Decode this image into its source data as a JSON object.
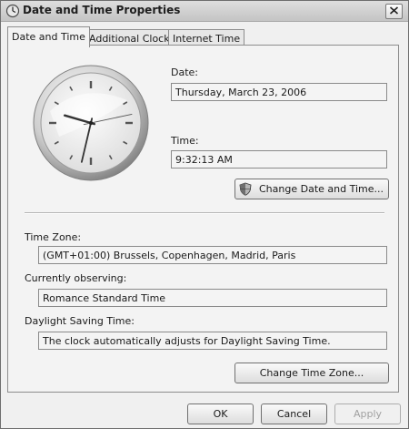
{
  "window": {
    "title": "Date and Time Properties",
    "app_icon": "date-time-icon",
    "close_icon": "close-icon"
  },
  "tabs": [
    {
      "label": "Date and Time",
      "active": true
    },
    {
      "label": "Additional Clocks",
      "active": false
    },
    {
      "label": "Internet Time",
      "active": false
    }
  ],
  "date": {
    "label": "Date:",
    "value": "Thursday, March 23, 2006"
  },
  "time": {
    "label": "Time:",
    "value": "9:32:13 AM"
  },
  "clock": {
    "hours": 9,
    "minutes": 32,
    "seconds": 13
  },
  "change_date_time_button": {
    "label": "Change Date and Time...",
    "icon": "shield-icon"
  },
  "time_zone": {
    "label": "Time Zone:",
    "value": "(GMT+01:00) Brussels, Copenhagen, Madrid, Paris"
  },
  "observing": {
    "label": "Currently observing:",
    "value": "Romance Standard Time"
  },
  "dst": {
    "label": "Daylight Saving Time:",
    "value": "The clock automatically adjusts for Daylight Saving Time."
  },
  "change_time_zone_button": {
    "label": "Change Time Zone..."
  },
  "footer": {
    "ok": "OK",
    "cancel": "Cancel",
    "apply": "Apply",
    "apply_enabled": false
  }
}
